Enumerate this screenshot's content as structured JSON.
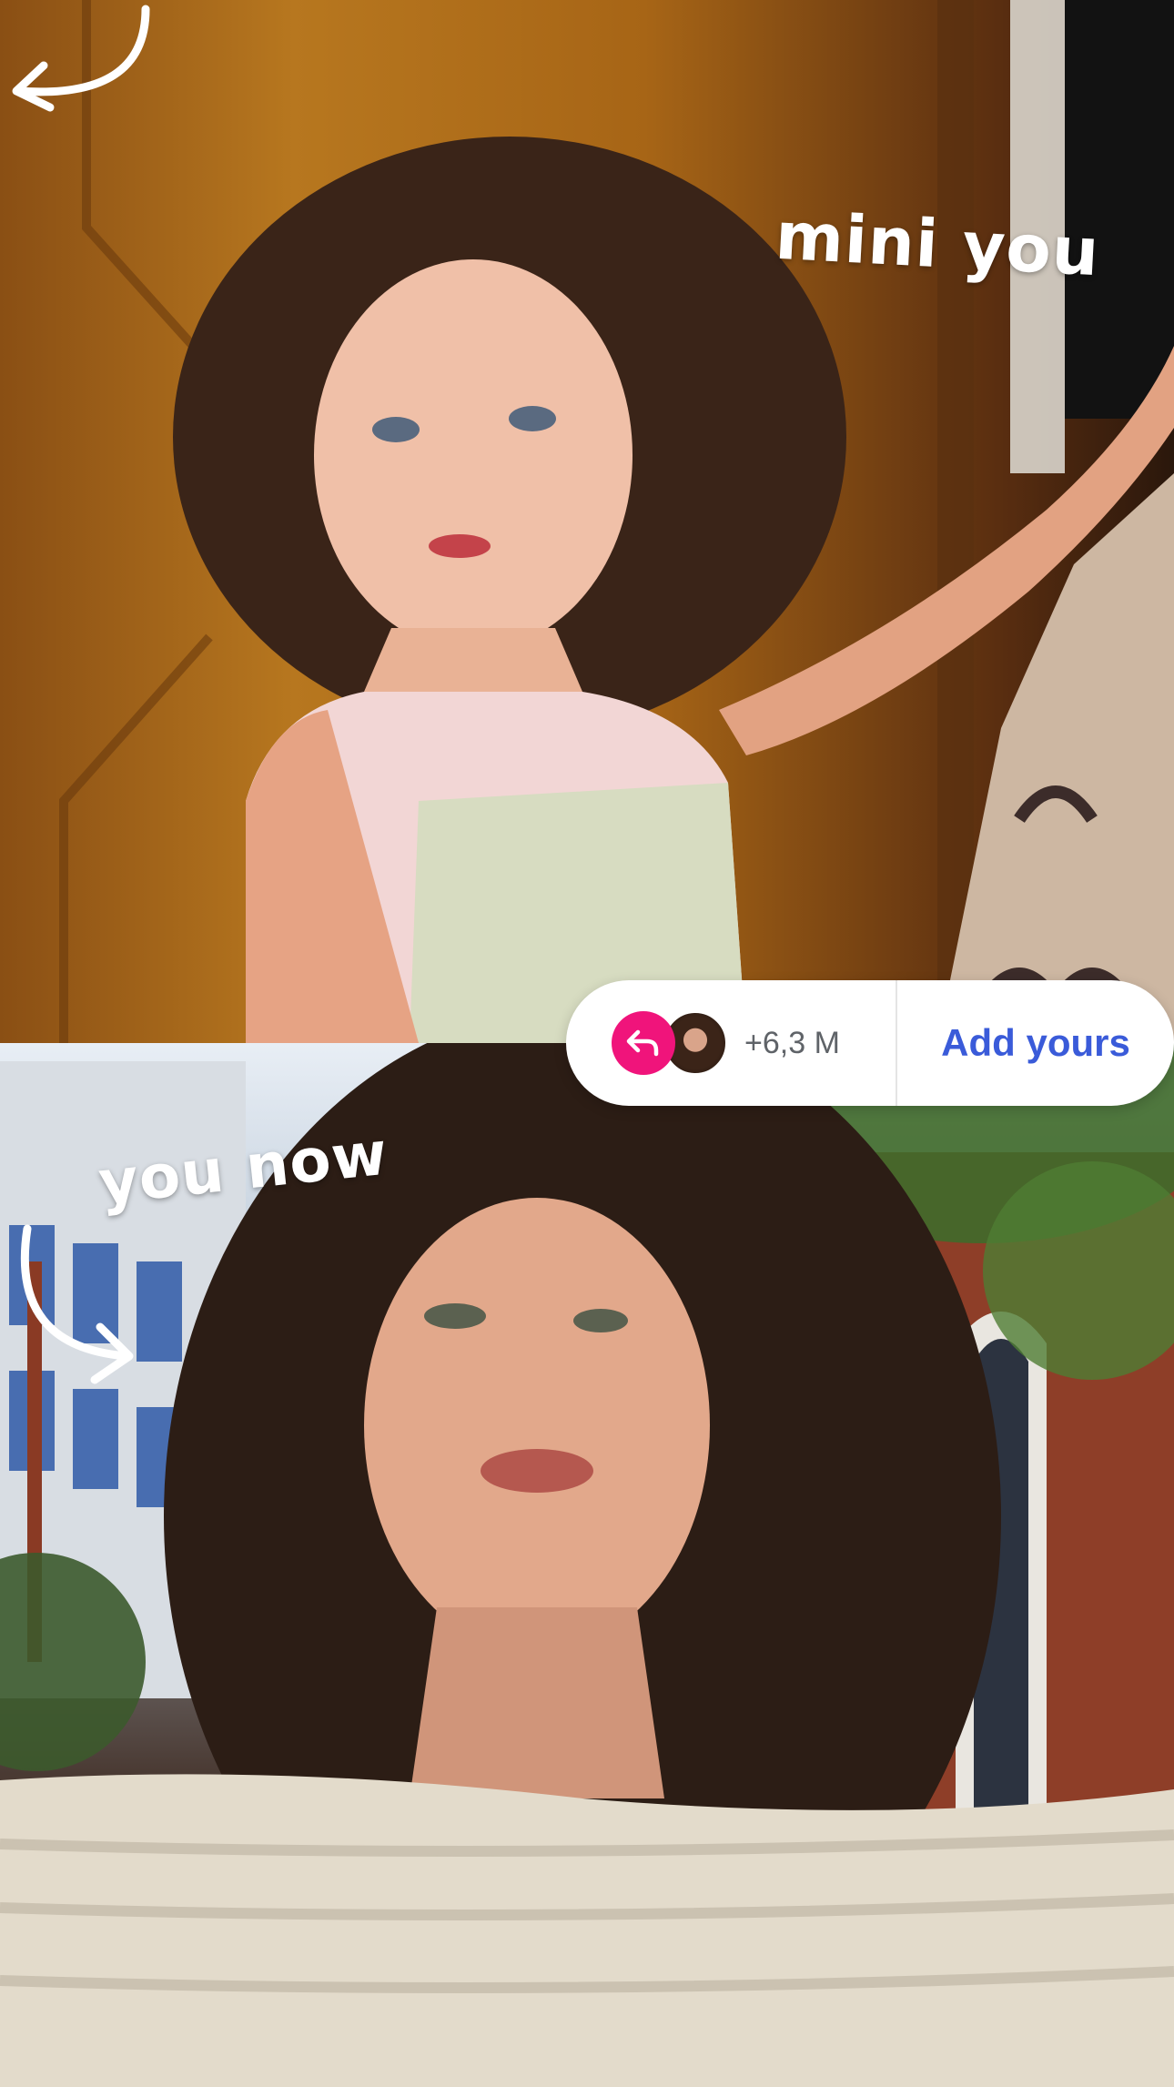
{
  "captions": {
    "top": "mini you",
    "bottom": "you now"
  },
  "sticker": {
    "reply_icon": "reply-arrow-icon",
    "avatar": "participant-avatar",
    "count": "+6,3 M",
    "action_label": "Add yours",
    "accent_color": "#f0147b",
    "action_color": "#3a5bd9"
  },
  "icons": [
    "reply-arrow-icon",
    "curved-arrow-icon"
  ]
}
